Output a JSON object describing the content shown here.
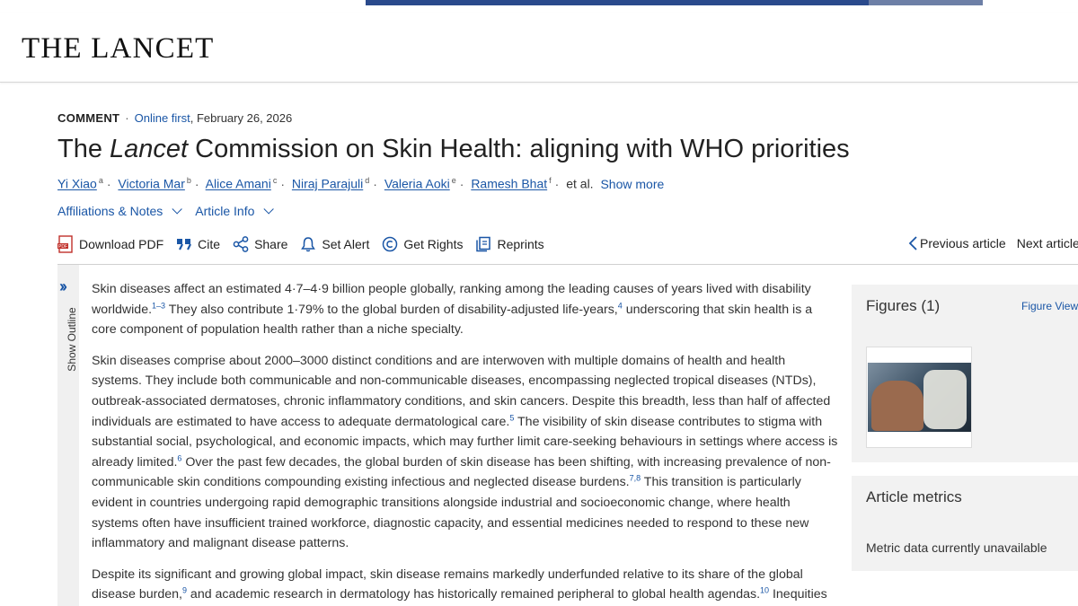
{
  "header": {
    "logo": "THE LANCET"
  },
  "article": {
    "type": "COMMENT",
    "online_first": "Online first",
    "date": ", February 26, 2026",
    "title_pre": "The ",
    "title_em": "Lancet",
    "title_post": " Commission on Skin Health: aligning with WHO priorities",
    "authors": [
      {
        "name": "Yi Xiao",
        "sup": "a"
      },
      {
        "name": "Victoria Mar",
        "sup": "b"
      },
      {
        "name": "Alice Amani",
        "sup": "c"
      },
      {
        "name": "Niraj Parajuli",
        "sup": "d"
      },
      {
        "name": "Valeria Aoki",
        "sup": "e"
      },
      {
        "name": "Ramesh Bhat",
        "sup": "f"
      }
    ],
    "et_al": "et al.",
    "show_more": "Show more",
    "affiliations": "Affiliations & Notes",
    "article_info": "Article Info"
  },
  "toolbar": {
    "download_pdf": "Download PDF",
    "cite": "Cite",
    "share": "Share",
    "set_alert": "Set Alert",
    "get_rights": "Get Rights",
    "reprints": "Reprints",
    "previous": "Previous article",
    "next": "Next article"
  },
  "outline": {
    "label": "Show Outline"
  },
  "body": {
    "p1": [
      "Skin diseases affect an estimated 4·7–4·9 billion people globally, ranking among the leading causes of years lived with disability worldwide.",
      "1–3",
      " They also contribute 1·79% to the global burden of disability-adjusted life-years,",
      "4",
      " underscoring that skin health is a core component of population health rather than a niche specialty."
    ],
    "p2": [
      "Skin diseases comprise about 2000–3000 distinct conditions and are interwoven with multiple domains of health and health systems. They include both communicable and non-communicable diseases, encompassing neglected tropical diseases (NTDs), outbreak-associated dermatoses, chronic inflammatory conditions, and skin cancers. Despite this breadth, less than half of affected individuals are estimated to have access to adequate dermatological care.",
      "5",
      " The visibility of skin disease contributes to stigma with substantial social, psychological, and economic impacts, which may further limit care-seeking behaviours in settings where access is already limited.",
      "6",
      " Over the past few decades, the global burden of skin disease has been shifting, with increasing prevalence of non-communicable skin conditions compounding existing infectious and neglected disease burdens.",
      "7,8",
      " This transition is particularly evident in countries undergoing rapid demographic transitions alongside industrial and socioeconomic change, where health systems often have insufficient trained workforce, diagnostic capacity, and essential medicines needed to respond to these new inflammatory and malignant disease patterns."
    ],
    "p3": [
      "Despite its significant and growing global impact, skin disease remains markedly underfunded relative to its share of the global disease burden,",
      "9",
      " and academic research in dermatology has historically remained peripheral to global health agendas.",
      "10",
      " Inequities"
    ]
  },
  "sidebar": {
    "figures_title": "Figures (1)",
    "figure_viewer": "Figure Viewer",
    "metrics_title": "Article metrics",
    "metrics_text": "Metric data currently unavailable"
  },
  "colors": {
    "link": "#1a56a6",
    "panel": "#f2f2f2",
    "ad": "#2a4a8c"
  }
}
